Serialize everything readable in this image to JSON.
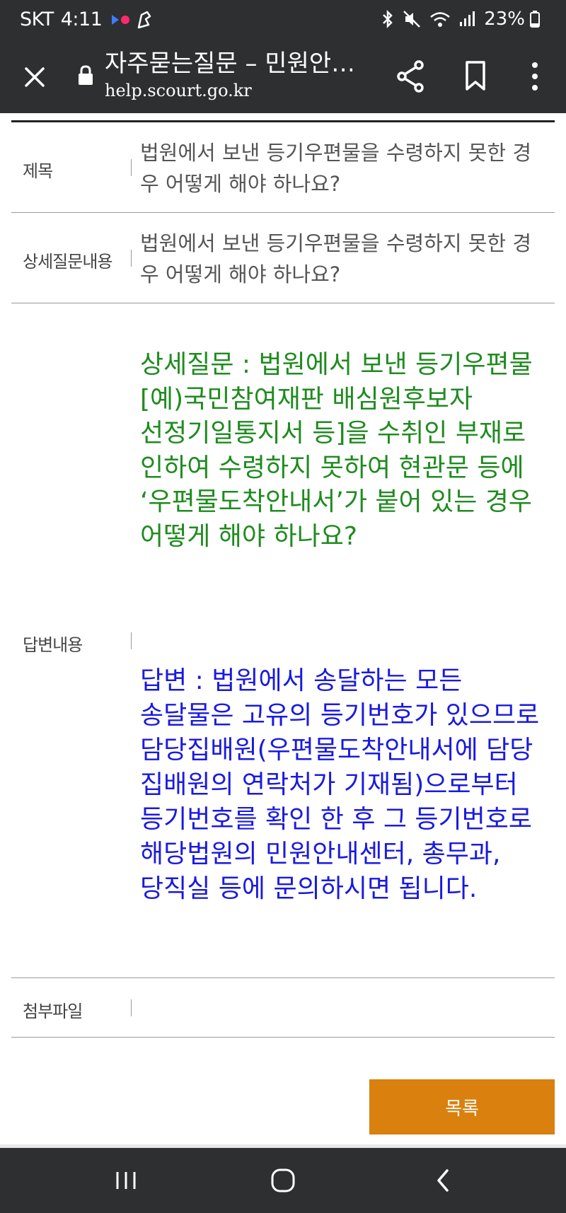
{
  "status_bar": {
    "carrier": "SKT",
    "time": "4:11",
    "battery": "23%"
  },
  "browser": {
    "title": "자주묻는질문 – 민원안…",
    "url": "help.scourt.go.kr"
  },
  "faq": {
    "subject_label": "제목",
    "subject_value": "법원에서 보낸 등기우편물을 수령하지 못한 경우 어떻게 해야 하나요?",
    "detail_label": "상세질문내용",
    "detail_value": "법원에서 보낸 등기우편물을 수령하지 못한 경우 어떻게 해야 하나요?",
    "detail_body": "상세질문 : 법원에서 보낸 등기우편물[예)국민참여재판 배심원후보자 선정기일통지서 등]을 수취인 부재로 인하여 수령하지 못하여 현관문 등에 ‘우편물도착안내서’가 붙어 있는 경우 어떻게 해야 하나요?",
    "answer_label": "답변내용",
    "answer_body": "답변 : 법원에서 송달하는 모든 송달물은 고유의 등기번호가 있으므로 담당집배원(우편물도착안내서에 담당 집배원의 연락처가 기재됨)으로부터 등기번호를 확인 한 후 그 등기번호로 해당법원의 민원안내센터, 총무과, 당직실 등에 문의하시면 됩니다.",
    "attachment_label": "첨부파일",
    "list_button": "목록"
  },
  "colors": {
    "question_text": "#1f8b1f",
    "answer_text": "#1a1adf",
    "list_button_bg": "#d9800e",
    "bar_bg": "#2e2f31"
  }
}
